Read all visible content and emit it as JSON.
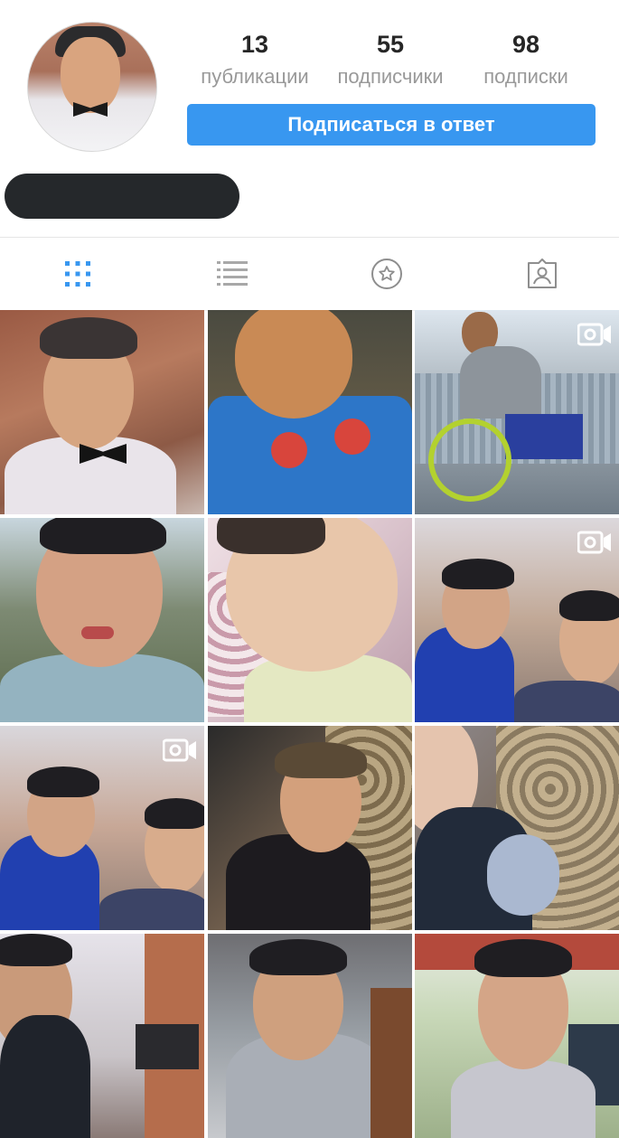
{
  "profile": {
    "stats": [
      {
        "value": "13",
        "label": "публикации"
      },
      {
        "value": "55",
        "label": "подписчики"
      },
      {
        "value": "98",
        "label": "подписки"
      }
    ],
    "follow_button": "Подписаться в ответ"
  },
  "tabs": [
    {
      "icon": "grid-icon",
      "active": true
    },
    {
      "icon": "list-icon",
      "active": false
    },
    {
      "icon": "saved-star-icon",
      "active": false
    },
    {
      "icon": "tagged-person-icon",
      "active": false
    }
  ],
  "colors": {
    "accent": "#3897f0",
    "stat_label": "#999999",
    "active_tab": "#3897f0",
    "inactive_tab": "#a8a8a8"
  },
  "posts": [
    {
      "type": "photo"
    },
    {
      "type": "photo"
    },
    {
      "type": "video"
    },
    {
      "type": "photo"
    },
    {
      "type": "photo"
    },
    {
      "type": "video"
    },
    {
      "type": "video"
    },
    {
      "type": "photo"
    },
    {
      "type": "photo"
    },
    {
      "type": "photo"
    },
    {
      "type": "photo"
    },
    {
      "type": "photo"
    }
  ]
}
